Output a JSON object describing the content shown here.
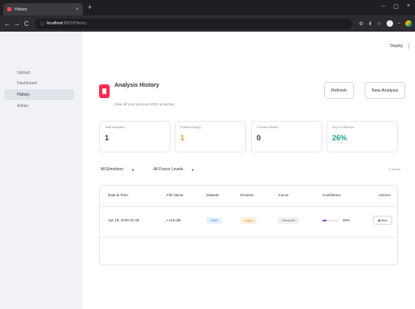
{
  "browser": {
    "tab_title": "History",
    "tab_close": "×",
    "new_tab": "+",
    "win_minimize": "–",
    "win_maximize": "▢",
    "win_close": "×",
    "back": "←",
    "forward": "→",
    "reload": "C",
    "url_host": "localhost",
    "url_path": ":8501/History"
  },
  "sidebar": {
    "items": [
      {
        "label": "Upload"
      },
      {
        "label": "Dashboard"
      },
      {
        "label": "History"
      },
      {
        "label": "Admin"
      }
    ]
  },
  "topbar": {
    "deploy": "Deploy",
    "menu": "⋮"
  },
  "header": {
    "title": "Analysis History",
    "subtitle": "View all your previous EEG analyses",
    "refresh_label": "Refresh",
    "new_analysis_label": "New Analysis"
  },
  "stats": [
    {
      "label": "Total Analyses",
      "value": "1"
    },
    {
      "label": "Positive/Happy",
      "value": "1"
    },
    {
      "label": "Focused States",
      "value": "0"
    },
    {
      "label": "Avg Confidence",
      "value": "26%"
    }
  ],
  "filters": {
    "emotions": "All Emotions",
    "focus": "All Focus Levels",
    "results": "1 results",
    "chevron": "▼"
  },
  "table": {
    "headers": [
      "Date & Time",
      "File Name",
      "Dataset",
      "Emotion",
      "Focus",
      "Confidence",
      "Actions"
    ],
    "rows": [
      {
        "date": "Apr 18, 2026 01:48",
        "file": "s15.dat",
        "dataset": "DEAP",
        "emotion": "Happy",
        "focus": "Distracted",
        "confidence_label": "26%",
        "confidence_value": 0.26,
        "action": "View"
      }
    ]
  },
  "colors": {
    "accent": "#ff2b54",
    "confidence_bar": "#7b3fe4",
    "happy": "#e69a1c",
    "teal": "#15a08a"
  }
}
